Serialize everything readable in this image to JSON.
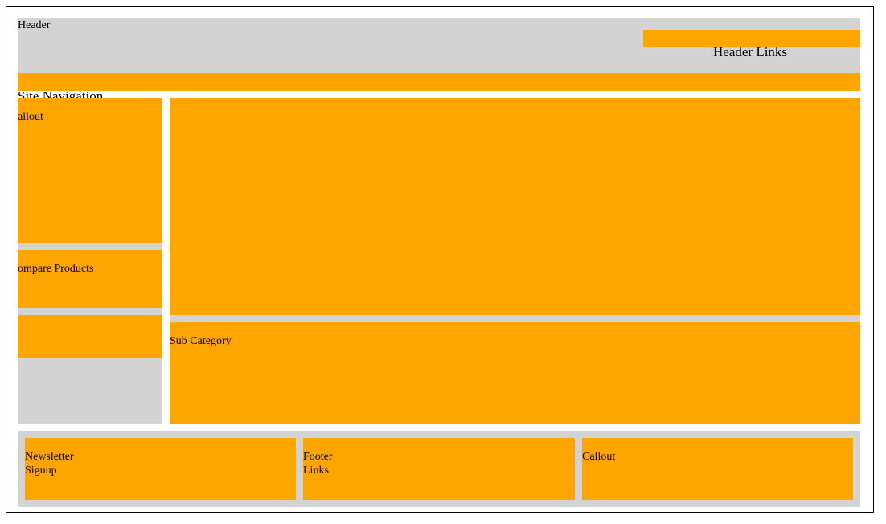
{
  "header": {
    "label": "Header",
    "links_label": "Header Links"
  },
  "site_navigation": {
    "label": "Site Navigation"
  },
  "sidebar": {
    "callout_label": "allout",
    "compare_label": "ompare Products"
  },
  "main": {
    "sub_category_label": "Sub Category"
  },
  "footer": {
    "newsletter_line1": "Newsletter",
    "newsletter_line2": "Signup",
    "links_line1": "Footer",
    "links_line2": "Links",
    "callout_label": "Callout"
  },
  "colors": {
    "gray": "#d3d3d3",
    "orange": "#ffa500"
  }
}
